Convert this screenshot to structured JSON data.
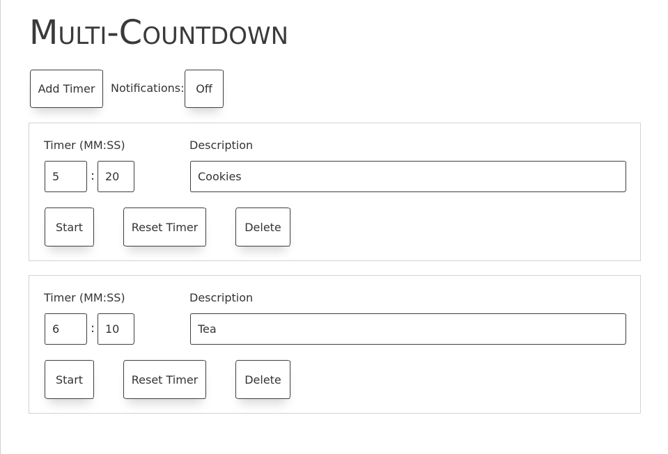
{
  "app": {
    "title": "Multi-Countdown"
  },
  "toolbar": {
    "add_timer_label": "Add Timer",
    "notifications_label": "Notifications:",
    "notifications_value": "Off"
  },
  "timers": [
    {
      "timer_label": "Timer (MM:SS)",
      "description_label": "Description",
      "minutes": "5",
      "seconds": "20",
      "description": "Cookies",
      "start_label": "Start",
      "reset_label": "Reset Timer",
      "delete_label": "Delete"
    },
    {
      "timer_label": "Timer (MM:SS)",
      "description_label": "Description",
      "minutes": "6",
      "seconds": "10",
      "description": "Tea",
      "start_label": "Start",
      "reset_label": "Reset Timer",
      "delete_label": "Delete"
    }
  ],
  "separator": ":"
}
